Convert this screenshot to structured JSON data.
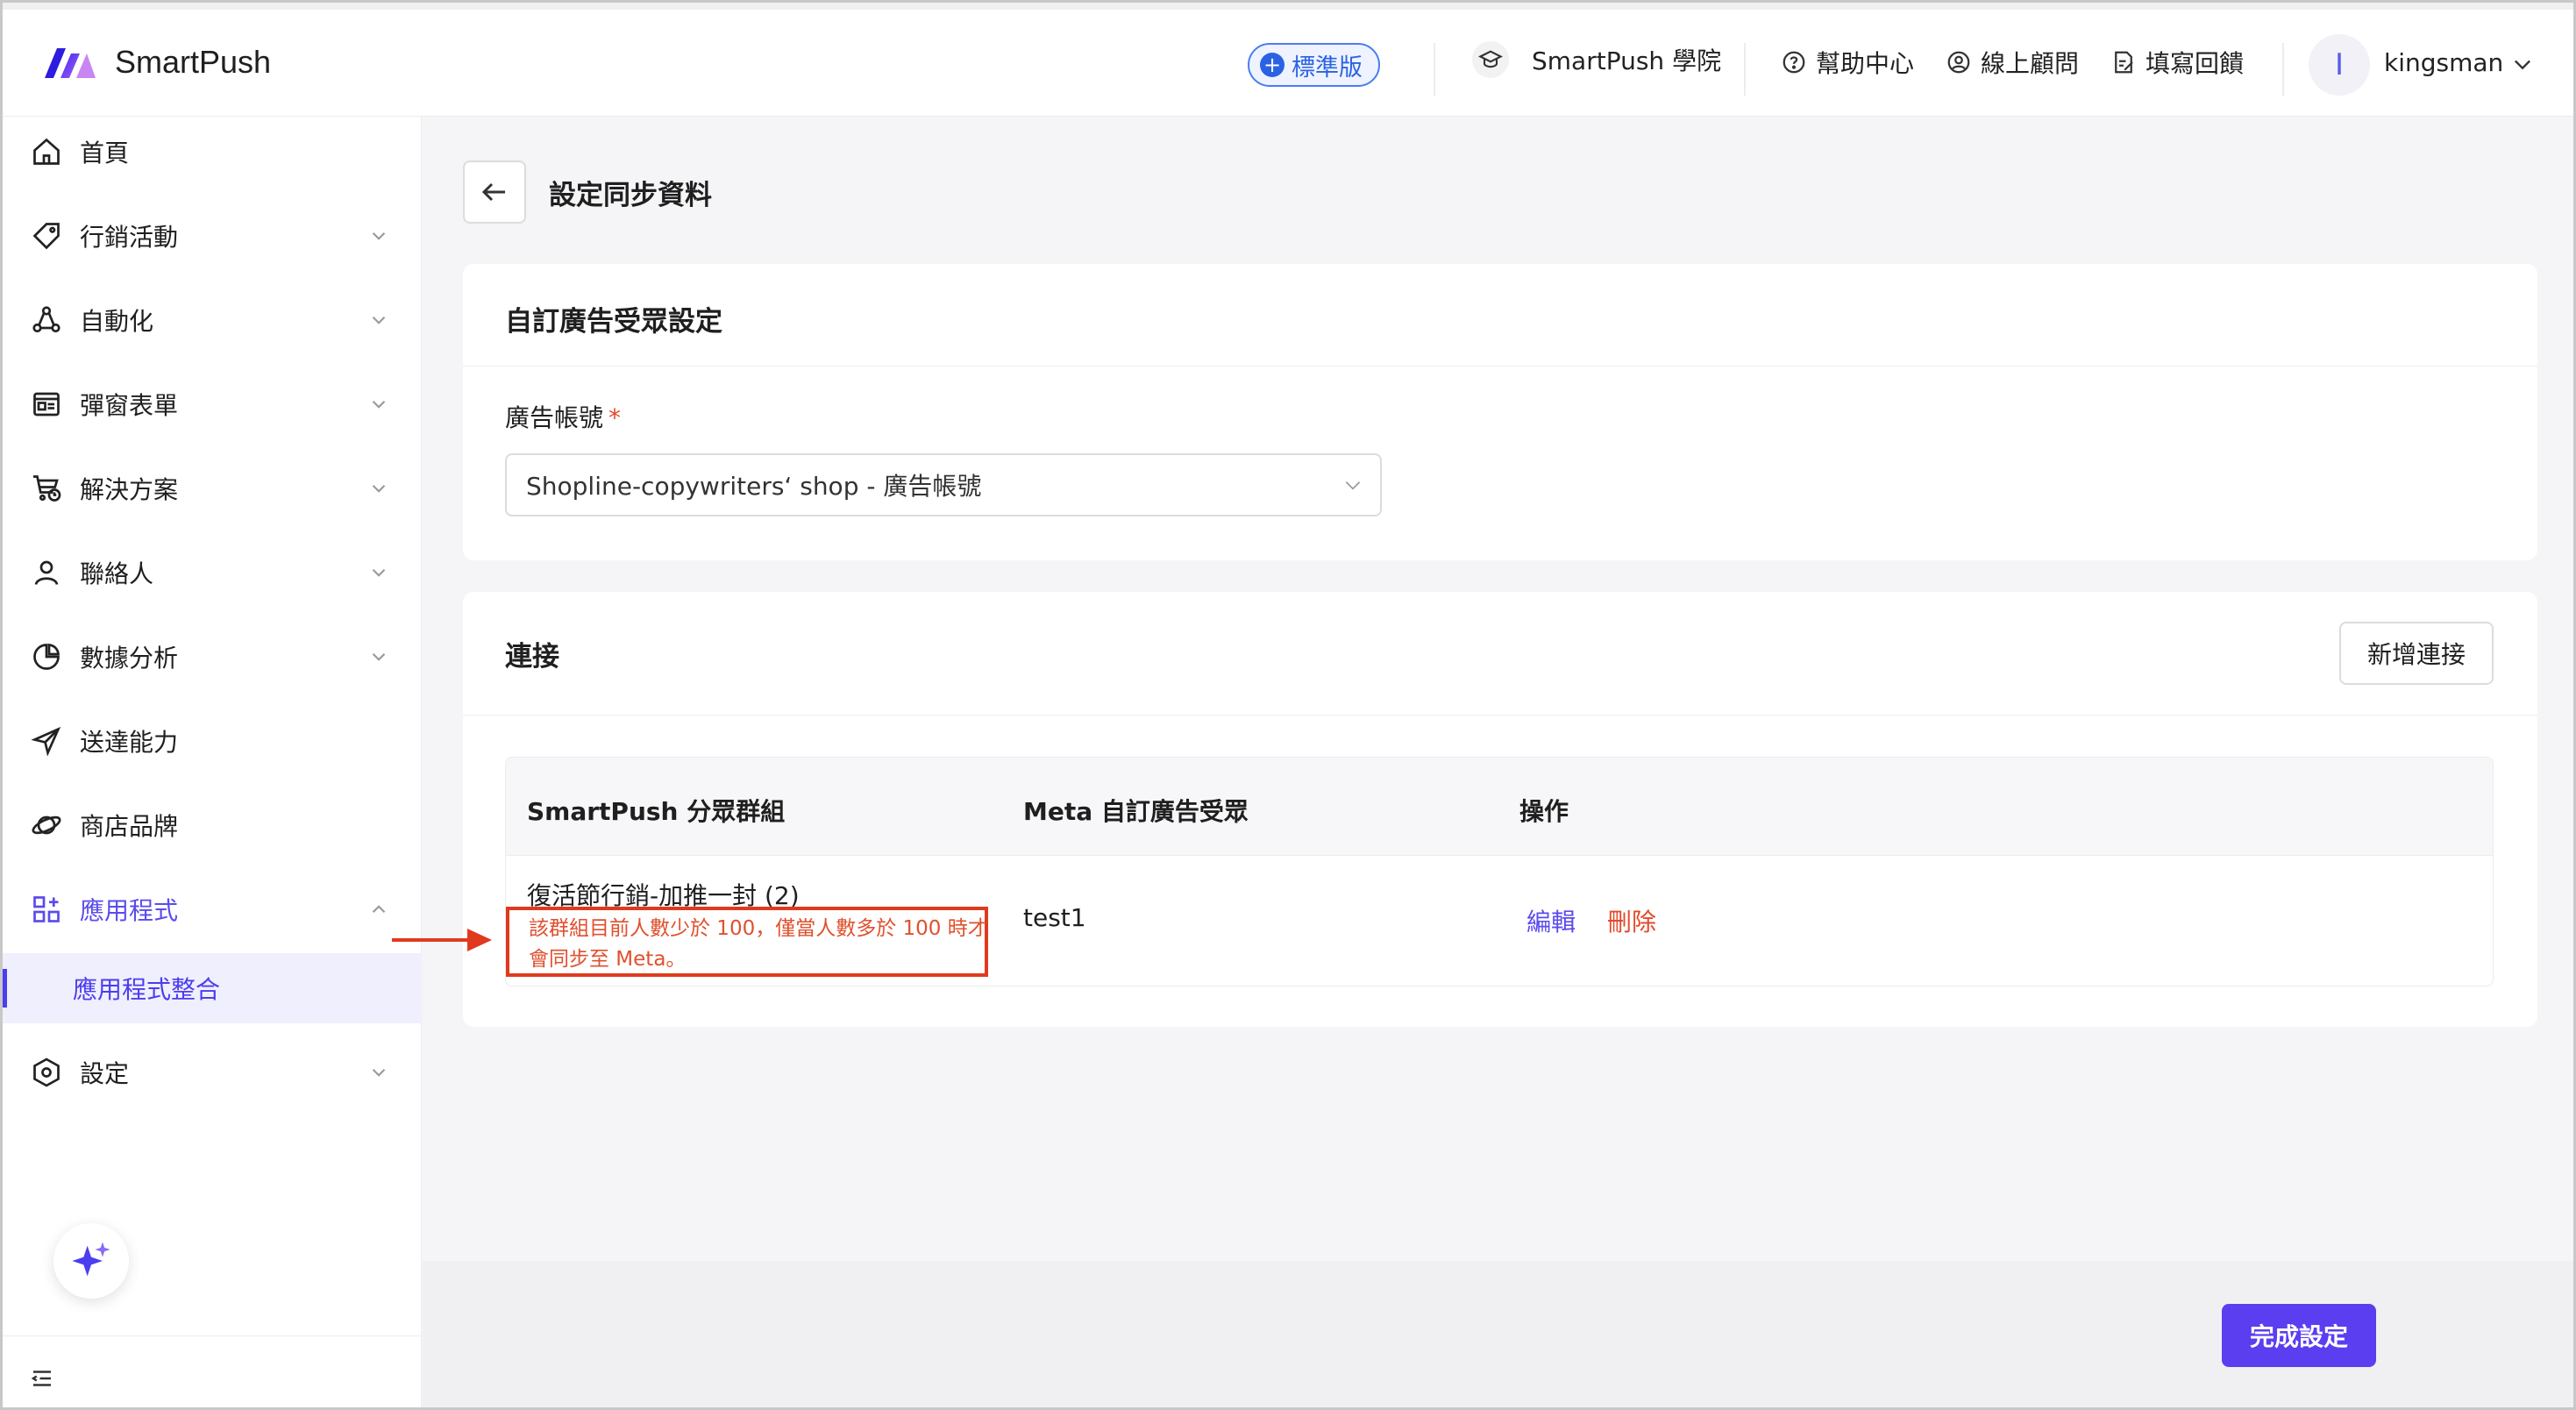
{
  "header": {
    "app_name": "SmartPush",
    "plan_badge": "標準版",
    "academy": "SmartPush 學院",
    "help_center": "幫助中心",
    "online_consultant": "線上顧問",
    "feedback": "填寫回饋",
    "avatar_initial": "I",
    "username": "kingsman"
  },
  "sidebar": {
    "items": [
      {
        "label": "首頁"
      },
      {
        "label": "行銷活動"
      },
      {
        "label": "自動化"
      },
      {
        "label": "彈窗表單"
      },
      {
        "label": "解決方案"
      },
      {
        "label": "聯絡人"
      },
      {
        "label": "數據分析"
      },
      {
        "label": "送達能力"
      },
      {
        "label": "商店品牌"
      },
      {
        "label": "應用程式"
      },
      {
        "label": "設定"
      }
    ],
    "sub_item": "應用程式整合"
  },
  "page": {
    "title": "設定同步資料"
  },
  "audience_card": {
    "title": "自訂廣告受眾設定",
    "field_label": "廣告帳號",
    "required_mark": "*",
    "selected_account": "Shopline-copywriters‘ shop - 廣告帳號"
  },
  "connection_card": {
    "title": "連接",
    "add_button": "新增連接",
    "columns": [
      "SmartPush 分眾群組",
      "Meta 自訂廣告受眾",
      "操作"
    ],
    "rows": [
      {
        "segment": "復活節行銷-加推一封 (2)",
        "warning": "該群組目前人數少於 100，僅當人數多於 100 時才會同步至 Meta。",
        "meta_audience": "test1",
        "edit": "編輯",
        "delete": "刪除"
      }
    ]
  },
  "footer": {
    "done_button": "完成設定"
  },
  "colors": {
    "accent": "#5a3ef0",
    "danger": "#e34a2b",
    "annotation": "#e03a1e"
  }
}
